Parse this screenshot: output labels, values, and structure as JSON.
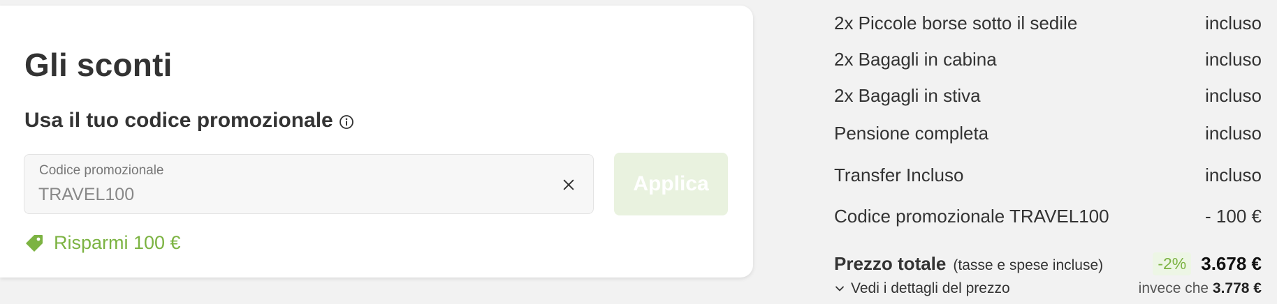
{
  "discounts": {
    "title": "Gli sconti",
    "promo_heading": "Usa il tuo codice promozionale",
    "promo_field": {
      "label": "Codice promozionale",
      "value": "TRAVEL100"
    },
    "apply_label": "Applica",
    "savings_text": "Risparmi 100 €"
  },
  "summary": {
    "items": [
      {
        "label": "2x Piccole borse sotto il sedile",
        "value": "incluso"
      },
      {
        "label": "2x Bagagli in cabina",
        "value": "incluso"
      },
      {
        "label": "2x Bagagli in stiva",
        "value": "incluso"
      },
      {
        "label": "Pensione completa",
        "value": "incluso"
      },
      {
        "label": "Transfer Incluso",
        "value": "incluso"
      },
      {
        "label": "Codice promozionale TRAVEL100",
        "value": "- 100 €"
      }
    ],
    "total_label": "Prezzo totale",
    "total_note": "(tasse e spese incluse)",
    "discount_badge": "-2%",
    "total_price": "3.678 €",
    "details_link": "Vedi i dettagli del prezzo",
    "instead_prefix": "invece che",
    "original_price": "3.778 €"
  },
  "colors": {
    "accent_green": "#7cb342",
    "apply_button_bg": "#e9f2df",
    "badge_bg": "#edf6e5"
  },
  "icons": [
    "info-icon",
    "close-icon",
    "tag-icon",
    "chevron-down-icon"
  ]
}
